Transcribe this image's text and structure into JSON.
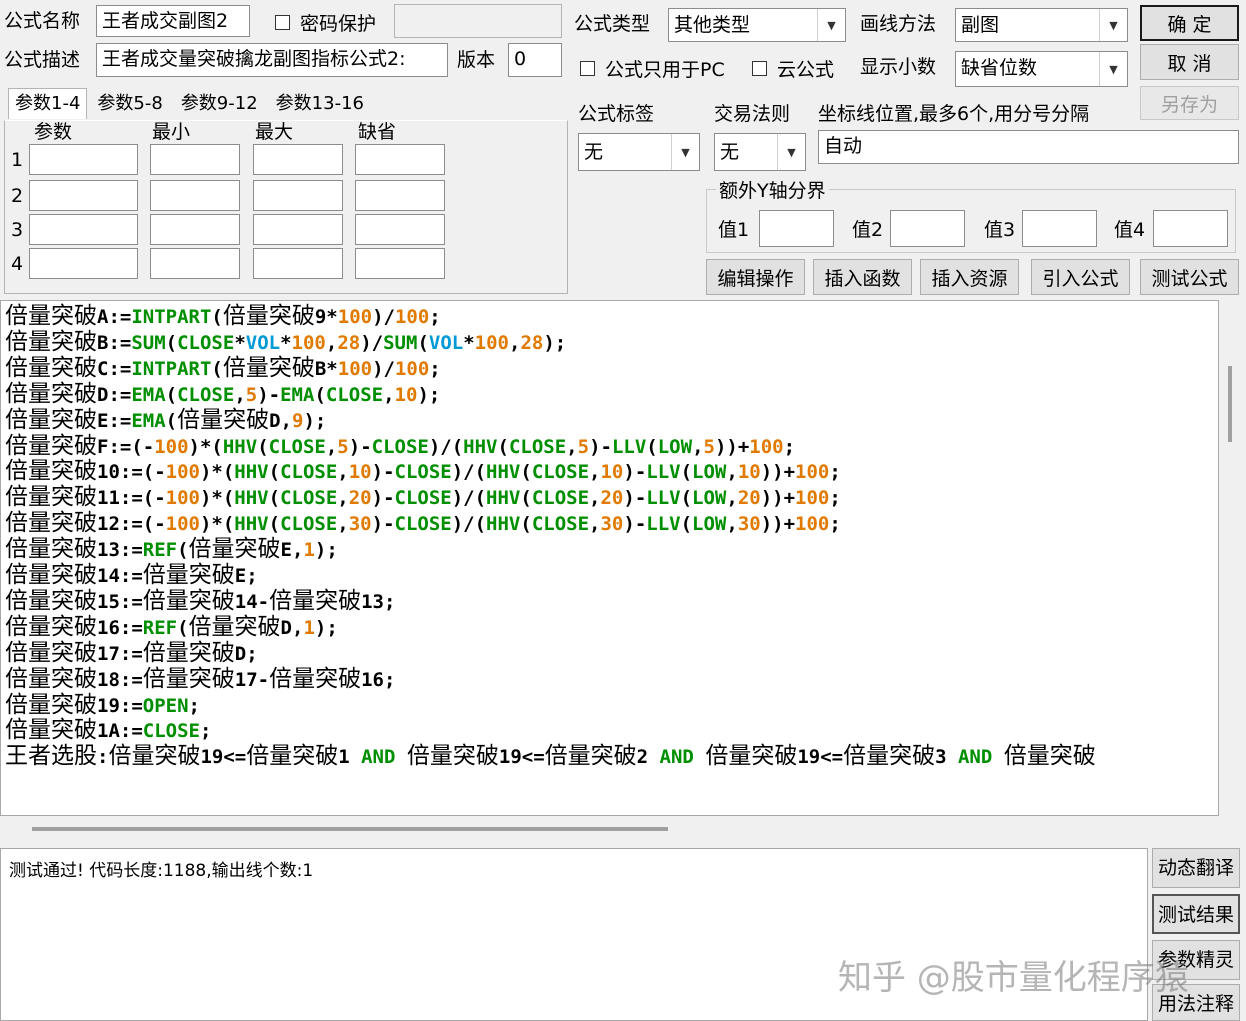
{
  "header": {
    "formula_name_label": "公式名称",
    "formula_name_value": "王者成交副图2",
    "password_label": "密码保护",
    "formula_desc_label": "公式描述",
    "formula_desc_value": "王者成交量突破擒龙副图指标公式2:",
    "version_label": "版本",
    "version_value": "0",
    "formula_type_label": "公式类型",
    "formula_type_value": "其他类型",
    "draw_method_label": "画线方法",
    "draw_method_value": "副图",
    "pc_only_label": "公式只用于PC",
    "cloud_label": "云公式",
    "decimals_label": "显示小数",
    "decimals_value": "缺省位数",
    "ok_button": "确 定",
    "cancel_button": "取 消",
    "save_as_button": "另存为"
  },
  "params": {
    "tabs": [
      "参数1-4",
      "参数5-8",
      "参数9-12",
      "参数13-16"
    ],
    "columns": [
      "参数",
      "最小",
      "最大",
      "缺省"
    ],
    "rows": [
      "1",
      "2",
      "3",
      "4"
    ]
  },
  "tags": {
    "tag_label": "公式标签",
    "tag_value": "无",
    "trade_rule_label": "交易法则",
    "trade_rule_value": "无",
    "axis_label": "坐标线位置,最多6个,用分号分隔",
    "axis_value": "自动",
    "y_axis_group": "额外Y轴分界",
    "y_values": [
      "值1",
      "值2",
      "值3",
      "值4"
    ]
  },
  "actions": [
    "编辑操作",
    "插入函数",
    "插入资源",
    "引入公式",
    "测试公式"
  ],
  "code": [
    [
      {
        "t": "倍量突破",
        "c": ""
      },
      {
        "t": "A:=",
        "c": "c"
      },
      {
        "t": "INTPART",
        "c": "k"
      },
      {
        "t": "(",
        "c": "c"
      },
      {
        "t": "倍量突破",
        "c": ""
      },
      {
        "t": "9*",
        "c": "c"
      },
      {
        "t": "100",
        "c": "n"
      },
      {
        "t": ")/",
        "c": "c"
      },
      {
        "t": "100",
        "c": "n"
      },
      {
        "t": ";",
        "c": "c"
      }
    ],
    [
      {
        "t": "倍量突破",
        "c": ""
      },
      {
        "t": "B:=",
        "c": "c"
      },
      {
        "t": "SUM",
        "c": "k"
      },
      {
        "t": "(",
        "c": "c"
      },
      {
        "t": "CLOSE",
        "c": "k"
      },
      {
        "t": "*",
        "c": "c"
      },
      {
        "t": "VOL",
        "c": "f"
      },
      {
        "t": "*",
        "c": "c"
      },
      {
        "t": "100",
        "c": "n"
      },
      {
        "t": ",",
        "c": "c"
      },
      {
        "t": "28",
        "c": "n"
      },
      {
        "t": ")/",
        "c": "c"
      },
      {
        "t": "SUM",
        "c": "k"
      },
      {
        "t": "(",
        "c": "c"
      },
      {
        "t": "VOL",
        "c": "f"
      },
      {
        "t": "*",
        "c": "c"
      },
      {
        "t": "100",
        "c": "n"
      },
      {
        "t": ",",
        "c": "c"
      },
      {
        "t": "28",
        "c": "n"
      },
      {
        "t": ");",
        "c": "c"
      }
    ],
    [
      {
        "t": "倍量突破",
        "c": ""
      },
      {
        "t": "C:=",
        "c": "c"
      },
      {
        "t": "INTPART",
        "c": "k"
      },
      {
        "t": "(",
        "c": "c"
      },
      {
        "t": "倍量突破",
        "c": ""
      },
      {
        "t": "B*",
        "c": "c"
      },
      {
        "t": "100",
        "c": "n"
      },
      {
        "t": ")/",
        "c": "c"
      },
      {
        "t": "100",
        "c": "n"
      },
      {
        "t": ";",
        "c": "c"
      }
    ],
    [
      {
        "t": "倍量突破",
        "c": ""
      },
      {
        "t": "D:=",
        "c": "c"
      },
      {
        "t": "EMA",
        "c": "k"
      },
      {
        "t": "(",
        "c": "c"
      },
      {
        "t": "CLOSE",
        "c": "k"
      },
      {
        "t": ",",
        "c": "c"
      },
      {
        "t": "5",
        "c": "n"
      },
      {
        "t": ")-",
        "c": "c"
      },
      {
        "t": "EMA",
        "c": "k"
      },
      {
        "t": "(",
        "c": "c"
      },
      {
        "t": "CLOSE",
        "c": "k"
      },
      {
        "t": ",",
        "c": "c"
      },
      {
        "t": "10",
        "c": "n"
      },
      {
        "t": ");",
        "c": "c"
      }
    ],
    [
      {
        "t": "倍量突破",
        "c": ""
      },
      {
        "t": "E:=",
        "c": "c"
      },
      {
        "t": "EMA",
        "c": "k"
      },
      {
        "t": "(",
        "c": "c"
      },
      {
        "t": "倍量突破",
        "c": ""
      },
      {
        "t": "D,",
        "c": "c"
      },
      {
        "t": "9",
        "c": "n"
      },
      {
        "t": ");",
        "c": "c"
      }
    ],
    [
      {
        "t": "倍量突破",
        "c": ""
      },
      {
        "t": "F:=(-",
        "c": "c"
      },
      {
        "t": "100",
        "c": "n"
      },
      {
        "t": ")*(",
        "c": "c"
      },
      {
        "t": "HHV",
        "c": "k"
      },
      {
        "t": "(",
        "c": "c"
      },
      {
        "t": "CLOSE",
        "c": "k"
      },
      {
        "t": ",",
        "c": "c"
      },
      {
        "t": "5",
        "c": "n"
      },
      {
        "t": ")-",
        "c": "c"
      },
      {
        "t": "CLOSE",
        "c": "k"
      },
      {
        "t": ")/(",
        "c": "c"
      },
      {
        "t": "HHV",
        "c": "k"
      },
      {
        "t": "(",
        "c": "c"
      },
      {
        "t": "CLOSE",
        "c": "k"
      },
      {
        "t": ",",
        "c": "c"
      },
      {
        "t": "5",
        "c": "n"
      },
      {
        "t": ")-",
        "c": "c"
      },
      {
        "t": "LLV",
        "c": "k"
      },
      {
        "t": "(",
        "c": "c"
      },
      {
        "t": "LOW",
        "c": "k"
      },
      {
        "t": ",",
        "c": "c"
      },
      {
        "t": "5",
        "c": "n"
      },
      {
        "t": "))+",
        "c": "c"
      },
      {
        "t": "100",
        "c": "n"
      },
      {
        "t": ";",
        "c": "c"
      }
    ],
    [
      {
        "t": "倍量突破",
        "c": ""
      },
      {
        "t": "10:=(-",
        "c": "c"
      },
      {
        "t": "100",
        "c": "n"
      },
      {
        "t": ")*(",
        "c": "c"
      },
      {
        "t": "HHV",
        "c": "k"
      },
      {
        "t": "(",
        "c": "c"
      },
      {
        "t": "CLOSE",
        "c": "k"
      },
      {
        "t": ",",
        "c": "c"
      },
      {
        "t": "10",
        "c": "n"
      },
      {
        "t": ")-",
        "c": "c"
      },
      {
        "t": "CLOSE",
        "c": "k"
      },
      {
        "t": ")/(",
        "c": "c"
      },
      {
        "t": "HHV",
        "c": "k"
      },
      {
        "t": "(",
        "c": "c"
      },
      {
        "t": "CLOSE",
        "c": "k"
      },
      {
        "t": ",",
        "c": "c"
      },
      {
        "t": "10",
        "c": "n"
      },
      {
        "t": ")-",
        "c": "c"
      },
      {
        "t": "LLV",
        "c": "k"
      },
      {
        "t": "(",
        "c": "c"
      },
      {
        "t": "LOW",
        "c": "k"
      },
      {
        "t": ",",
        "c": "c"
      },
      {
        "t": "10",
        "c": "n"
      },
      {
        "t": "))+",
        "c": "c"
      },
      {
        "t": "100",
        "c": "n"
      },
      {
        "t": ";",
        "c": "c"
      }
    ],
    [
      {
        "t": "倍量突破",
        "c": ""
      },
      {
        "t": "11:=(-",
        "c": "c"
      },
      {
        "t": "100",
        "c": "n"
      },
      {
        "t": ")*(",
        "c": "c"
      },
      {
        "t": "HHV",
        "c": "k"
      },
      {
        "t": "(",
        "c": "c"
      },
      {
        "t": "CLOSE",
        "c": "k"
      },
      {
        "t": ",",
        "c": "c"
      },
      {
        "t": "20",
        "c": "n"
      },
      {
        "t": ")-",
        "c": "c"
      },
      {
        "t": "CLOSE",
        "c": "k"
      },
      {
        "t": ")/(",
        "c": "c"
      },
      {
        "t": "HHV",
        "c": "k"
      },
      {
        "t": "(",
        "c": "c"
      },
      {
        "t": "CLOSE",
        "c": "k"
      },
      {
        "t": ",",
        "c": "c"
      },
      {
        "t": "20",
        "c": "n"
      },
      {
        "t": ")-",
        "c": "c"
      },
      {
        "t": "LLV",
        "c": "k"
      },
      {
        "t": "(",
        "c": "c"
      },
      {
        "t": "LOW",
        "c": "k"
      },
      {
        "t": ",",
        "c": "c"
      },
      {
        "t": "20",
        "c": "n"
      },
      {
        "t": "))+",
        "c": "c"
      },
      {
        "t": "100",
        "c": "n"
      },
      {
        "t": ";",
        "c": "c"
      }
    ],
    [
      {
        "t": "倍量突破",
        "c": ""
      },
      {
        "t": "12:=(-",
        "c": "c"
      },
      {
        "t": "100",
        "c": "n"
      },
      {
        "t": ")*(",
        "c": "c"
      },
      {
        "t": "HHV",
        "c": "k"
      },
      {
        "t": "(",
        "c": "c"
      },
      {
        "t": "CLOSE",
        "c": "k"
      },
      {
        "t": ",",
        "c": "c"
      },
      {
        "t": "30",
        "c": "n"
      },
      {
        "t": ")-",
        "c": "c"
      },
      {
        "t": "CLOSE",
        "c": "k"
      },
      {
        "t": ")/(",
        "c": "c"
      },
      {
        "t": "HHV",
        "c": "k"
      },
      {
        "t": "(",
        "c": "c"
      },
      {
        "t": "CLOSE",
        "c": "k"
      },
      {
        "t": ",",
        "c": "c"
      },
      {
        "t": "30",
        "c": "n"
      },
      {
        "t": ")-",
        "c": "c"
      },
      {
        "t": "LLV",
        "c": "k"
      },
      {
        "t": "(",
        "c": "c"
      },
      {
        "t": "LOW",
        "c": "k"
      },
      {
        "t": ",",
        "c": "c"
      },
      {
        "t": "30",
        "c": "n"
      },
      {
        "t": "))+",
        "c": "c"
      },
      {
        "t": "100",
        "c": "n"
      },
      {
        "t": ";",
        "c": "c"
      }
    ],
    [
      {
        "t": "倍量突破",
        "c": ""
      },
      {
        "t": "13:=",
        "c": "c"
      },
      {
        "t": "REF",
        "c": "k"
      },
      {
        "t": "(",
        "c": "c"
      },
      {
        "t": "倍量突破",
        "c": ""
      },
      {
        "t": "E,",
        "c": "c"
      },
      {
        "t": "1",
        "c": "n"
      },
      {
        "t": ");",
        "c": "c"
      }
    ],
    [
      {
        "t": "倍量突破",
        "c": ""
      },
      {
        "t": "14:=",
        "c": "c"
      },
      {
        "t": "倍量突破",
        "c": ""
      },
      {
        "t": "E;",
        "c": "c"
      }
    ],
    [
      {
        "t": "倍量突破",
        "c": ""
      },
      {
        "t": "15:=",
        "c": "c"
      },
      {
        "t": "倍量突破",
        "c": ""
      },
      {
        "t": "14-",
        "c": "c"
      },
      {
        "t": "倍量突破",
        "c": ""
      },
      {
        "t": "13;",
        "c": "c"
      }
    ],
    [
      {
        "t": "倍量突破",
        "c": ""
      },
      {
        "t": "16:=",
        "c": "c"
      },
      {
        "t": "REF",
        "c": "k"
      },
      {
        "t": "(",
        "c": "c"
      },
      {
        "t": "倍量突破",
        "c": ""
      },
      {
        "t": "D,",
        "c": "c"
      },
      {
        "t": "1",
        "c": "n"
      },
      {
        "t": ");",
        "c": "c"
      }
    ],
    [
      {
        "t": "倍量突破",
        "c": ""
      },
      {
        "t": "17:=",
        "c": "c"
      },
      {
        "t": "倍量突破",
        "c": ""
      },
      {
        "t": "D;",
        "c": "c"
      }
    ],
    [
      {
        "t": "倍量突破",
        "c": ""
      },
      {
        "t": "18:=",
        "c": "c"
      },
      {
        "t": "倍量突破",
        "c": ""
      },
      {
        "t": "17-",
        "c": "c"
      },
      {
        "t": "倍量突破",
        "c": ""
      },
      {
        "t": "16;",
        "c": "c"
      }
    ],
    [
      {
        "t": "倍量突破",
        "c": ""
      },
      {
        "t": "19:=",
        "c": "c"
      },
      {
        "t": "OPEN",
        "c": "k"
      },
      {
        "t": ";",
        "c": "c"
      }
    ],
    [
      {
        "t": "倍量突破",
        "c": ""
      },
      {
        "t": "1A:=",
        "c": "c"
      },
      {
        "t": "CLOSE",
        "c": "k"
      },
      {
        "t": ";",
        "c": "c"
      }
    ],
    [
      {
        "t": "王者选股",
        "c": ""
      },
      {
        "t": ":",
        "c": "c"
      },
      {
        "t": "倍量突破",
        "c": ""
      },
      {
        "t": "19<=",
        "c": "c"
      },
      {
        "t": "倍量突破",
        "c": ""
      },
      {
        "t": "1 ",
        "c": "c"
      },
      {
        "t": "AND",
        "c": "k"
      },
      {
        "t": " ",
        "c": "c"
      },
      {
        "t": "倍量突破",
        "c": ""
      },
      {
        "t": "19<=",
        "c": "c"
      },
      {
        "t": "倍量突破",
        "c": ""
      },
      {
        "t": "2 ",
        "c": "c"
      },
      {
        "t": "AND",
        "c": "k"
      },
      {
        "t": " ",
        "c": "c"
      },
      {
        "t": "倍量突破",
        "c": ""
      },
      {
        "t": "19<=",
        "c": "c"
      },
      {
        "t": "倍量突破",
        "c": ""
      },
      {
        "t": "3 ",
        "c": "c"
      },
      {
        "t": "AND",
        "c": "k"
      },
      {
        "t": " ",
        "c": "c"
      },
      {
        "t": "倍量突破",
        "c": ""
      }
    ]
  ],
  "output": {
    "message": "测试通过! 代码长度:1188,输出线个数:1"
  },
  "side_buttons": [
    "动态翻译",
    "测试结果",
    "参数精灵",
    "用法注释"
  ],
  "watermark": "知乎 @股市量化程序猿"
}
